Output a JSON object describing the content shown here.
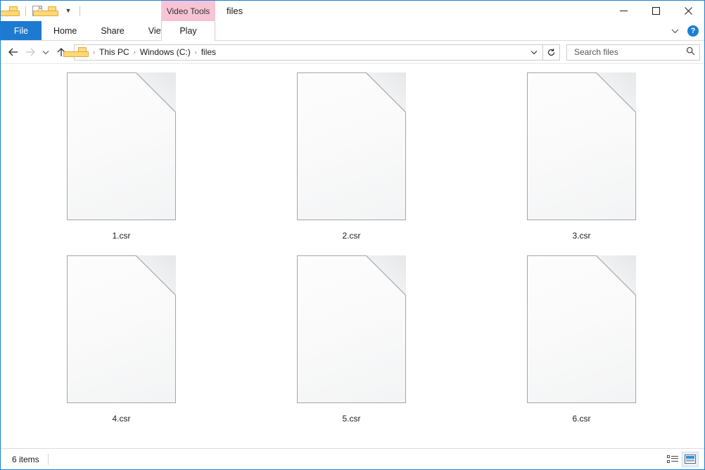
{
  "window": {
    "title": "files",
    "contextual_tab_group": "Video Tools",
    "border_color": "#1a7fd4"
  },
  "quick_access_toolbar": {
    "items": [
      {
        "name": "new-folder-icon",
        "label": "New folder"
      },
      {
        "name": "properties-icon",
        "label": "Properties"
      },
      {
        "name": "folder-icon",
        "label": "Folder"
      },
      {
        "name": "customize-chevron-icon",
        "label": "Customize Quick Access Toolbar"
      }
    ]
  },
  "window_controls": {
    "minimize": "─",
    "maximize": "☐",
    "close": "✕"
  },
  "ribbon": {
    "file_tab": "File",
    "tabs": [
      {
        "label": "Home"
      },
      {
        "label": "Share"
      },
      {
        "label": "View"
      }
    ],
    "contextual_tab": {
      "label": "Play",
      "group": "Video Tools",
      "group_color": "#f7c4d6"
    },
    "collapse_icon": "∨",
    "help_icon": "?",
    "file_tab_color": "#1e7ad0"
  },
  "navigation": {
    "back": "←",
    "forward": "→",
    "recent_locations": "∨",
    "up": "↑",
    "refresh": "↻",
    "address_dropdown": "∨"
  },
  "breadcrumb": {
    "folder_icon": "folder-icon",
    "separator": "›",
    "items": [
      {
        "label": "This PC"
      },
      {
        "label": "Windows (C:)"
      },
      {
        "label": "files"
      }
    ]
  },
  "search": {
    "placeholder": "Search files",
    "value": "",
    "icon": "search-icon"
  },
  "files": [
    {
      "name": "1.csr",
      "icon": "blank-document-icon"
    },
    {
      "name": "2.csr",
      "icon": "blank-document-icon"
    },
    {
      "name": "3.csr",
      "icon": "blank-document-icon"
    },
    {
      "name": "4.csr",
      "icon": "blank-document-icon"
    },
    {
      "name": "5.csr",
      "icon": "blank-document-icon"
    },
    {
      "name": "6.csr",
      "icon": "blank-document-icon"
    }
  ],
  "status_bar": {
    "item_count": "6 items",
    "views": [
      {
        "name": "details-view-button",
        "label": "Details view",
        "active": false
      },
      {
        "name": "large-icons-view-button",
        "label": "Large icons view",
        "active": true
      }
    ]
  }
}
